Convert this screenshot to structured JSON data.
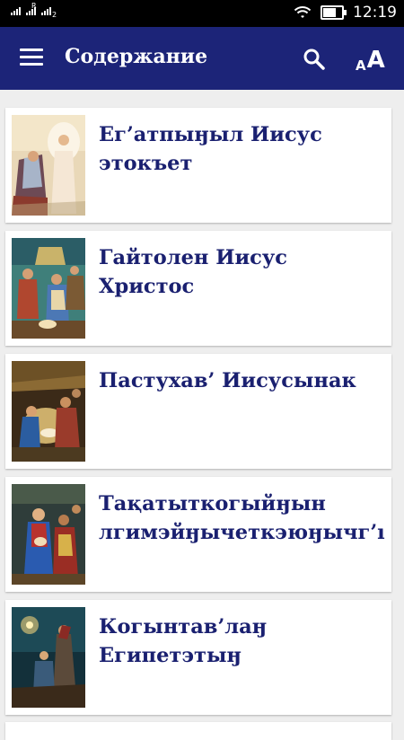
{
  "status_bar": {
    "sim1_label": "R",
    "sim2_label": "2",
    "time": "12:19"
  },
  "app_bar": {
    "title": "Содержание",
    "menu_icon": "hamburger-menu-icon",
    "search_icon": "search-icon",
    "font_size_icon": "font-size-icon",
    "font_size_label_small": "A",
    "font_size_label_big": "A",
    "color": "#1c2478"
  },
  "chapters": [
    {
      "title_line1": "Ег’атпыӈыл Иисус",
      "title_line2": "этокъет",
      "image": "annunciation-painting"
    },
    {
      "title_line1": "Гайтолен Иисус",
      "title_line2": "Христос",
      "image": "nativity-painting"
    },
    {
      "title_line1": "Пастухав’ Иисусынак",
      "title_line2": "",
      "image": "shepherds-painting"
    },
    {
      "title_line1": "Тақатыткогыйӈын",
      "title_line2": "лгимэйӈычеткэюӈычг’ı",
      "image": "magi-painting"
    },
    {
      "title_line1": "Когынтав’лаӈ",
      "title_line2": "Египетэтыӈ",
      "image": "flight-to-egypt-painting"
    }
  ],
  "colors": {
    "title_text": "#1a2070",
    "background": "#eeeeee",
    "card": "#ffffff"
  }
}
